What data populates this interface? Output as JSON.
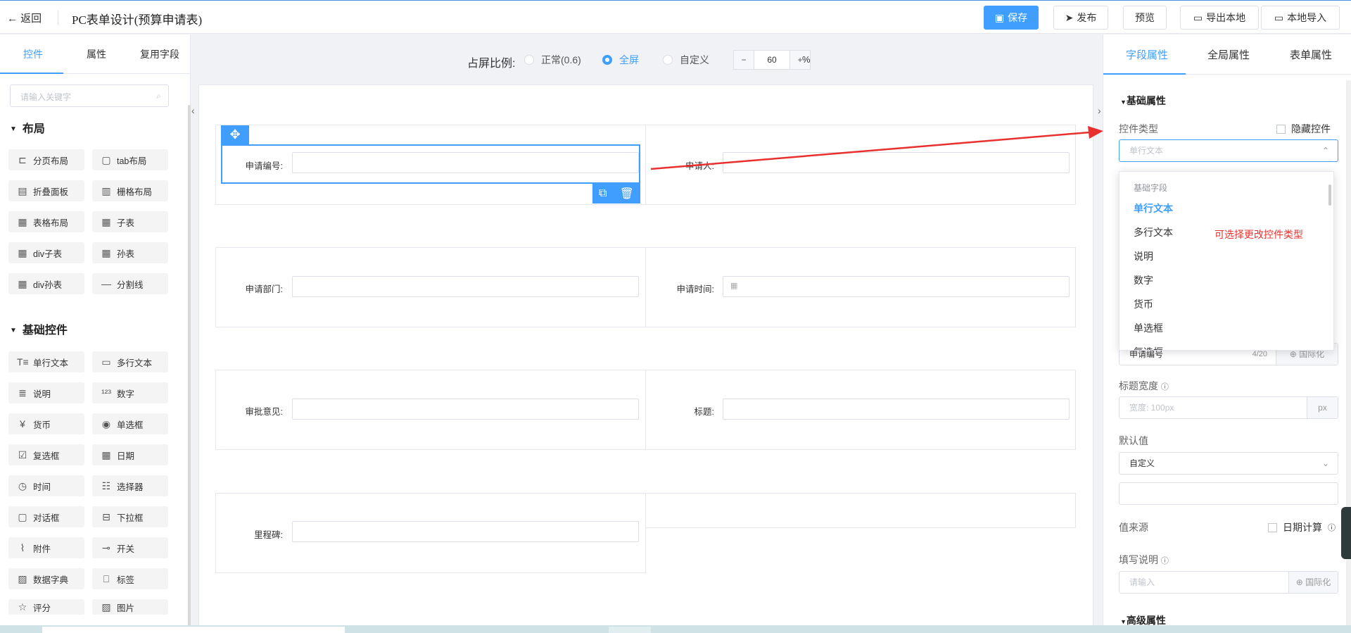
{
  "header": {
    "back": "返回",
    "title": "PC表单设计(预算申请表)",
    "save": "保存",
    "publish": "发布",
    "preview": "预览",
    "export": "导出本地",
    "import": "本地导入"
  },
  "left": {
    "tabs": [
      "控件",
      "属性",
      "复用字段"
    ],
    "search_placeholder": "请输入关键字",
    "layout_title": "布局",
    "layout_items": [
      "分页布局",
      "tab布局",
      "折叠面板",
      "栅格布局",
      "表格布局",
      "子表",
      "div子表",
      "孙表",
      "div孙表",
      "分割线"
    ],
    "basic_title": "基础控件",
    "basic_items": [
      "单行文本",
      "多行文本",
      "说明",
      "数字",
      "货币",
      "单选框",
      "复选框",
      "日期",
      "时间",
      "选择器",
      "对话框",
      "下拉框",
      "附件",
      "开关",
      "数据字典",
      "标签",
      "评分",
      "图片"
    ]
  },
  "canvas": {
    "ratio_label": "占屏比例:",
    "ratio_normal": "正常(0.6)",
    "ratio_full": "全屏",
    "ratio_custom": "自定义",
    "zoom_value": "60",
    "zoom_unit": "%",
    "fields": {
      "apply_no": "申请编号:",
      "applicant": "申请人:",
      "dept": "申请部门:",
      "time": "申请时间:",
      "opinion": "审批意见:",
      "subject": "标题:",
      "milestone": "里程碑:"
    }
  },
  "right": {
    "tabs": [
      "字段属性",
      "全局属性",
      "表单属性"
    ],
    "basic_attr": "基础属性",
    "ctl_type_label": "控件类型",
    "hide_ctl": "隐藏控件",
    "ctl_type_value": "单行文本",
    "title_width_label": "标题宽度",
    "title_width_placeholder": "宽度: 100px",
    "title_width_unit": "px",
    "default_label": "默认值",
    "default_value": "自定义",
    "value_source_label": "值来源",
    "date_calc": "日期计算",
    "fill_desc_label": "填写说明",
    "fill_desc_placeholder": "请输入",
    "i18n": "国际化",
    "behind_value": "申请编号",
    "behind_count": "4/20",
    "advanced_attr": "高级属性",
    "dropdown_group": "基础字段",
    "dropdown_items": [
      "单行文本",
      "多行文本",
      "说明",
      "数字",
      "货币",
      "单选框",
      "复选框"
    ],
    "annotation": "可选择更改控件类型"
  },
  "colors": {
    "accent": "#409eff",
    "annotation": "#e8312f"
  }
}
